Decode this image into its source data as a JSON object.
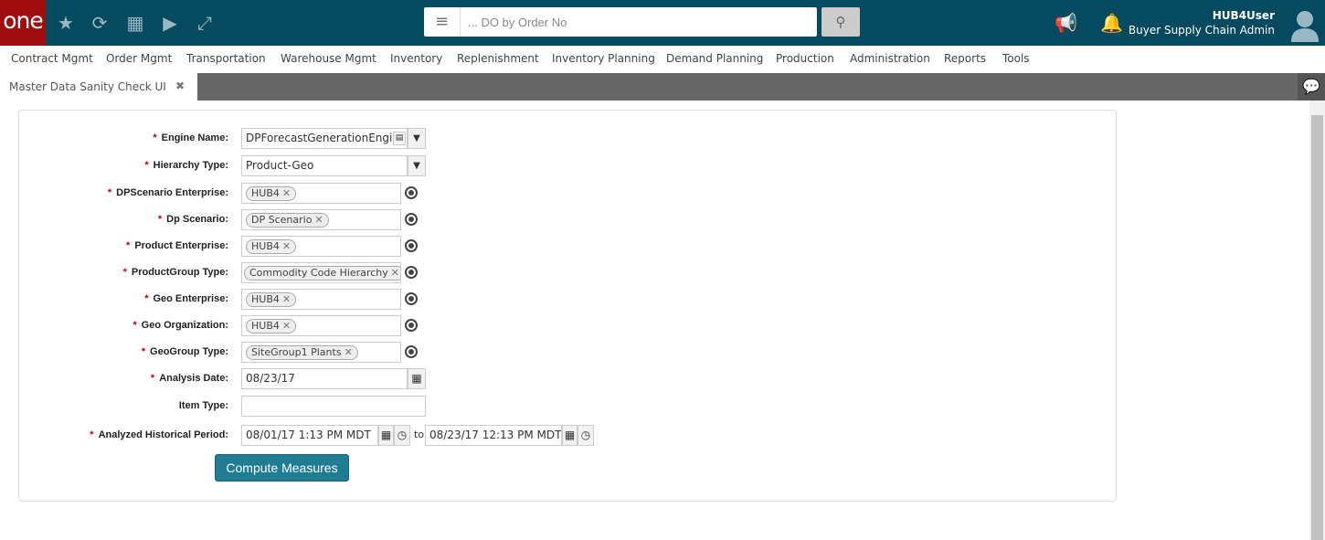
{
  "header": {
    "logo": "one",
    "search_placeholder": "... DO by Order No",
    "user_name": "HUB4User",
    "user_role": "Buyer Supply Chain Admin"
  },
  "nav": [
    "Contract Mgmt",
    "Order Mgmt",
    "Transportation",
    "Warehouse Mgmt",
    "Inventory",
    "Replenishment",
    "Inventory Planning",
    "Demand Planning",
    "Production",
    "Administration",
    "Reports",
    "Tools"
  ],
  "tab": {
    "title": "Master Data Sanity Check UI",
    "close": "✖"
  },
  "form": {
    "engine_name": {
      "label": "Engine Name:",
      "value": "DPForecastGenerationEngine"
    },
    "hierarchy_type": {
      "label": "Hierarchy Type:",
      "value": "Product-Geo"
    },
    "dpscenario_enterprise": {
      "label": "DPScenario Enterprise:",
      "tag": "HUB4"
    },
    "dp_scenario": {
      "label": "Dp Scenario:",
      "tag": "DP Scenario"
    },
    "product_enterprise": {
      "label": "Product Enterprise:",
      "tag": "HUB4"
    },
    "productgroup_type": {
      "label": "ProductGroup Type:",
      "tag": "Commodity Code Hierarchy"
    },
    "geo_enterprise": {
      "label": "Geo Enterprise:",
      "tag": "HUB4"
    },
    "geo_organization": {
      "label": "Geo Organization:",
      "tag": "HUB4"
    },
    "geogroup_type": {
      "label": "GeoGroup Type:",
      "tag": "SiteGroup1 Plants"
    },
    "analysis_date": {
      "label": "Analysis Date:",
      "value": "08/23/17"
    },
    "item_type": {
      "label": "Item Type:",
      "value": ""
    },
    "historical_period": {
      "label": "Analyzed Historical Period:",
      "from": "08/01/17 1:13 PM MDT",
      "to_label": "to",
      "to": "08/23/17 12:13 PM MDT"
    },
    "required_mark": "*",
    "submit": "Compute Measures"
  }
}
